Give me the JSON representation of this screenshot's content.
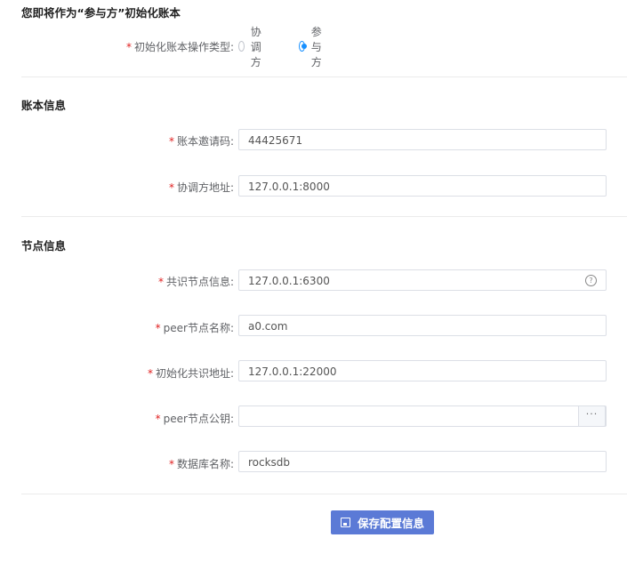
{
  "header": {
    "title": "您即将作为“参与方”初始化账本"
  },
  "init_type": {
    "label": "初始化账本操作类型:",
    "options": [
      {
        "label": "协调方",
        "checked": false
      },
      {
        "label": "参与方",
        "checked": true
      }
    ]
  },
  "ledger_info": {
    "title": "账本信息",
    "invite_code": {
      "label": "账本邀请码:",
      "value": "44425671"
    },
    "coordinator_address": {
      "label": "协调方地址:",
      "value": "127.0.0.1:8000"
    }
  },
  "node_info": {
    "title": "节点信息",
    "consensus_node": {
      "label": "共识节点信息:",
      "value": "127.0.0.1:6300",
      "help_icon": "help-circle-icon"
    },
    "peer_name": {
      "label": "peer节点名称:",
      "value": "a0.com"
    },
    "init_consensus_address": {
      "label": "初始化共识地址:",
      "value": "127.0.0.1:22000"
    },
    "peer_public_key": {
      "label": "peer节点公钥:",
      "value": "",
      "append_label": "···"
    },
    "db_name": {
      "label": "数据库名称:",
      "value": "rocksdb"
    }
  },
  "actions": {
    "save_label": "保存配置信息",
    "save_icon": "save-icon"
  },
  "colors": {
    "primary": "#5b7ad6",
    "required": "#e02020",
    "radio_checked": "#1890ff"
  }
}
